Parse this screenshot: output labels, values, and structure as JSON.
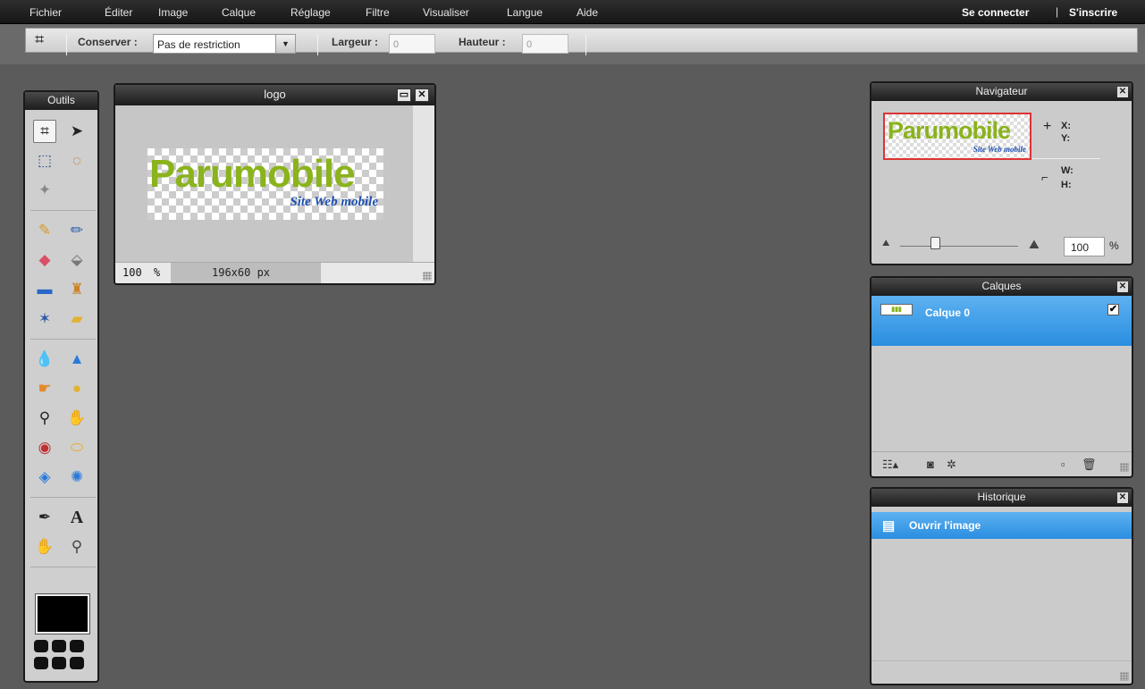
{
  "menu": [
    "Fichier",
    "Éditer",
    "Image",
    "Calque",
    "Réglage",
    "Filtre",
    "Visualiser",
    "Langue",
    "Aide"
  ],
  "auth": {
    "login": "Se connecter",
    "separator": "|",
    "signup": "S'inscrire"
  },
  "options": {
    "conserver_label": "Conserver :",
    "conserver_value": "Pas de restriction",
    "largeur_label": "Largeur :",
    "largeur_value": "0",
    "hauteur_label": "Hauteur :",
    "hauteur_value": "0"
  },
  "tools_panel": {
    "title": "Outils"
  },
  "document": {
    "title": "logo",
    "zoom": "100",
    "zoom_unit": "%",
    "size": "196x60 px",
    "logo_main": "Parumobile",
    "logo_sub": "Site Web mobile"
  },
  "navigator": {
    "title": "Navigateur",
    "x_label": "X:",
    "y_label": "Y:",
    "w_label": "W:",
    "h_label": "H:",
    "zoom_value": "100",
    "zoom_unit": "%",
    "zoom_level": 0.3
  },
  "layers": {
    "title": "Calques",
    "items": [
      {
        "name": "Calque 0",
        "visible": true
      }
    ]
  },
  "history": {
    "title": "Historique",
    "items": [
      {
        "label": "Ouvrir l'image"
      }
    ]
  },
  "colors": {
    "accent": "#2a8ee0",
    "logo_green": "#8ab31c",
    "logo_blue": "#1c4fb0",
    "foreground": "#000000"
  }
}
